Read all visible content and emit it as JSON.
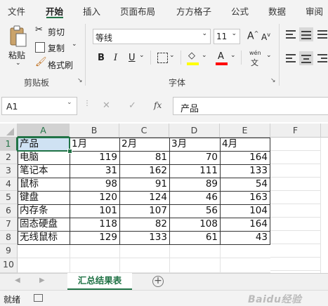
{
  "ribbon_tabs": [
    "文件",
    "开始",
    "插入",
    "页面布局",
    "方方格子",
    "公式",
    "数据",
    "审阅"
  ],
  "clipboard": {
    "paste": "粘贴",
    "cut": "剪切",
    "copy": "复制",
    "format_painter": "格式刷",
    "group": "剪贴板"
  },
  "font": {
    "name": "等线",
    "size": "11",
    "grow": "A",
    "shrink": "A",
    "bold": "B",
    "italic": "I",
    "underline": "U",
    "font_color_glyph": "A",
    "phonetic_top": "wén",
    "phonetic_bottom": "文",
    "group": "字体"
  },
  "colors": {
    "accent": "#217346",
    "highlight_yellow": "#ffff00",
    "font_red": "#ff0000",
    "selected_cell": "#cfe2f3"
  },
  "name_box": "A1",
  "formula_buttons": {
    "cancel": "✕",
    "enter": "✓",
    "fx": "fx"
  },
  "formula_value": "产品",
  "columns": [
    "A",
    "B",
    "C",
    "D",
    "E",
    "F"
  ],
  "rows": [
    "1",
    "2",
    "3",
    "4",
    "5",
    "6",
    "7",
    "8",
    "9",
    "10"
  ],
  "table": {
    "header": [
      "产品",
      "1月",
      "2月",
      "3月",
      "4月"
    ],
    "rows": [
      [
        "电脑",
        "119",
        "81",
        "70",
        "164"
      ],
      [
        "笔记本",
        "31",
        "162",
        "111",
        "133"
      ],
      [
        "鼠标",
        "98",
        "91",
        "89",
        "54"
      ],
      [
        "键盘",
        "120",
        "124",
        "46",
        "163"
      ],
      [
        "内存条",
        "101",
        "107",
        "56",
        "104"
      ],
      [
        "固态硬盘",
        "118",
        "82",
        "108",
        "164"
      ],
      [
        "无线鼠标",
        "129",
        "133",
        "61",
        "43"
      ]
    ]
  },
  "sheet_tab": "汇总结果表",
  "add_sheet": "+",
  "status": "就绪",
  "watermark": "Baidu经验"
}
